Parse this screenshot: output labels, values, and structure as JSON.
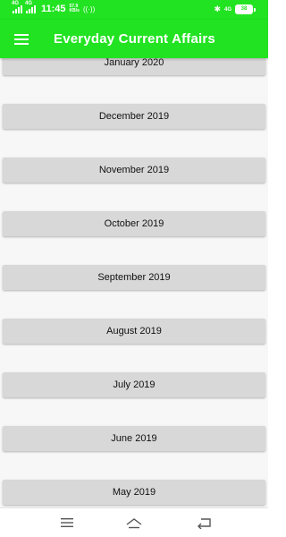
{
  "status_bar": {
    "time": "11:45",
    "network_1": "4G",
    "network_2": "4G",
    "speed_value": "57.9",
    "speed_unit": "KB/s",
    "data_label": "4G",
    "battery_level": "38"
  },
  "app_bar": {
    "title": "Everyday Current Affairs",
    "menu_icon": "hamburger-menu-icon"
  },
  "months": [
    {
      "label": "January 2020"
    },
    {
      "label": "December 2019"
    },
    {
      "label": "November 2019"
    },
    {
      "label": "October 2019"
    },
    {
      "label": "September 2019"
    },
    {
      "label": "August 2019"
    },
    {
      "label": "July 2019"
    },
    {
      "label": "June 2019"
    },
    {
      "label": "May 2019"
    }
  ],
  "nav_bar": {
    "icons": [
      "recents-icon",
      "home-icon",
      "back-icon"
    ]
  },
  "colors": {
    "accent": "#22e322",
    "button_bg": "#d8d8d8",
    "page_bg": "#f7f7f7"
  }
}
